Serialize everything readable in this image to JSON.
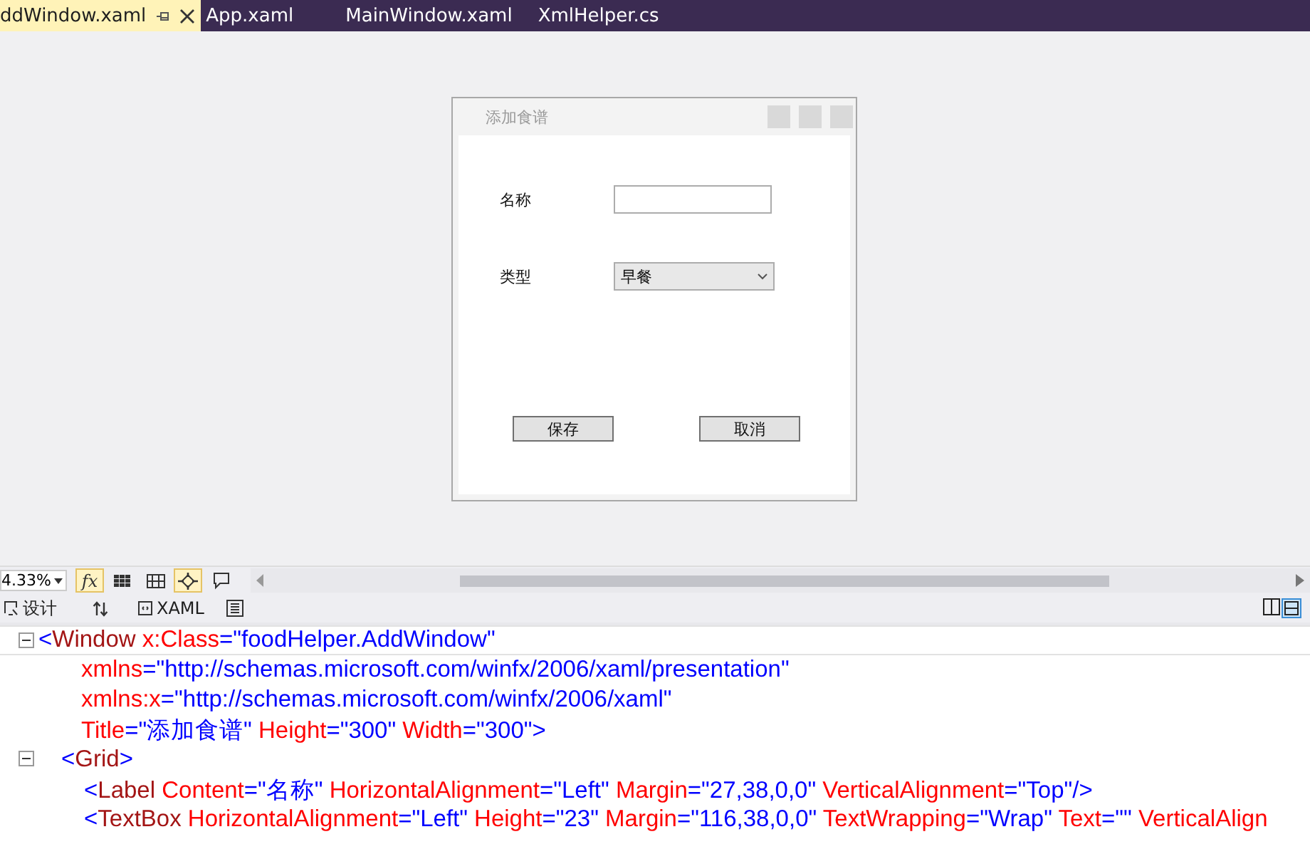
{
  "tabs": [
    {
      "label": "ddWindow.xaml",
      "selected": true
    },
    {
      "label": "App.xaml",
      "selected": false
    },
    {
      "label": "MainWindow.xaml",
      "selected": false
    },
    {
      "label": "XmlHelper.cs",
      "selected": false
    }
  ],
  "dialog": {
    "title": "添加食谱",
    "fields": [
      {
        "kind": "text",
        "label": "名称"
      },
      {
        "kind": "combo",
        "label": "类型",
        "value": "早餐"
      }
    ],
    "buttons": [
      "保存",
      "取消"
    ]
  },
  "toolbar": {
    "zoom": "4.33%",
    "tools": [
      {
        "kind": "formula",
        "label": "fx",
        "on": true
      },
      {
        "kind": "grid",
        "on": false
      },
      {
        "kind": "grid-dots",
        "on": false
      },
      {
        "kind": "snap",
        "on": true
      },
      {
        "kind": "comment",
        "on": false
      }
    ]
  },
  "view_tabs": [
    {
      "kind": "design",
      "label": "设计"
    },
    {
      "kind": "swap"
    },
    {
      "kind": "xaml",
      "label": "XAML"
    },
    {
      "kind": "doc"
    }
  ],
  "code": [
    {
      "expanded": true,
      "tokens": [
        {
          "kind": "punct",
          "text": "<"
        },
        {
          "kind": "element",
          "text": "Window"
        },
        {
          "kind": "attribute",
          "text": " x:Class"
        },
        {
          "kind": "value",
          "text": "=\"foodHelper.AddWindow\""
        }
      ],
      "children": [
        {
          "kind": "continuation",
          "tokens": [
            {
              "kind": "attribute",
              "text": "xmlns"
            },
            {
              "kind": "value",
              "text": "=\"http://schemas.microsoft.com/winfx/2006/xaml/presentation\""
            }
          ]
        },
        {
          "kind": "continuation",
          "tokens": [
            {
              "kind": "attribute",
              "text": "xmlns:x"
            },
            {
              "kind": "value",
              "text": "=\"http://schemas.microsoft.com/winfx/2006/xaml\""
            }
          ]
        },
        {
          "kind": "continuation",
          "tokens": [
            {
              "kind": "attribute",
              "text": "Title"
            },
            {
              "kind": "value",
              "text": "=\"添加食谱\""
            },
            {
              "kind": "attribute",
              "text": " Height"
            },
            {
              "kind": "value",
              "text": "=\"300\""
            },
            {
              "kind": "attribute",
              "text": " Width"
            },
            {
              "kind": "value",
              "text": "=\"300\">"
            }
          ]
        },
        {
          "expanded": true,
          "tokens": [
            {
              "kind": "punct",
              "text": "<"
            },
            {
              "kind": "element",
              "text": "Grid"
            },
            {
              "kind": "punct",
              "text": ">"
            }
          ],
          "children": [
            {
              "tokens": [
                {
                  "kind": "punct",
                  "text": "<"
                },
                {
                  "kind": "element",
                  "text": "Label"
                },
                {
                  "kind": "attribute",
                  "text": " Content"
                },
                {
                  "kind": "value",
                  "text": "=\"名称\""
                },
                {
                  "kind": "attribute",
                  "text": " HorizontalAlignment"
                },
                {
                  "kind": "value",
                  "text": "=\"Left\""
                },
                {
                  "kind": "attribute",
                  "text": " Margin"
                },
                {
                  "kind": "value",
                  "text": "=\"27,38,0,0\""
                },
                {
                  "kind": "attribute",
                  "text": " VerticalAlignment"
                },
                {
                  "kind": "value",
                  "text": "=\"Top\"/>"
                }
              ]
            },
            {
              "tokens": [
                {
                  "kind": "punct",
                  "text": "<"
                },
                {
                  "kind": "element",
                  "text": "TextBox"
                },
                {
                  "kind": "attribute",
                  "text": " HorizontalAlignment"
                },
                {
                  "kind": "value",
                  "text": "=\"Left\""
                },
                {
                  "kind": "attribute",
                  "text": " Height"
                },
                {
                  "kind": "value",
                  "text": "=\"23\""
                },
                {
                  "kind": "attribute",
                  "text": " Margin"
                },
                {
                  "kind": "value",
                  "text": "=\"116,38,0,0\""
                },
                {
                  "kind": "attribute",
                  "text": " TextWrapping"
                },
                {
                  "kind": "value",
                  "text": "=\"Wrap\""
                },
                {
                  "kind": "attribute",
                  "text": " Text"
                },
                {
                  "kind": "value",
                  "text": "=\"\""
                },
                {
                  "kind": "attribute",
                  "text": " VerticalAlign"
                }
              ]
            }
          ]
        }
      ]
    }
  ]
}
